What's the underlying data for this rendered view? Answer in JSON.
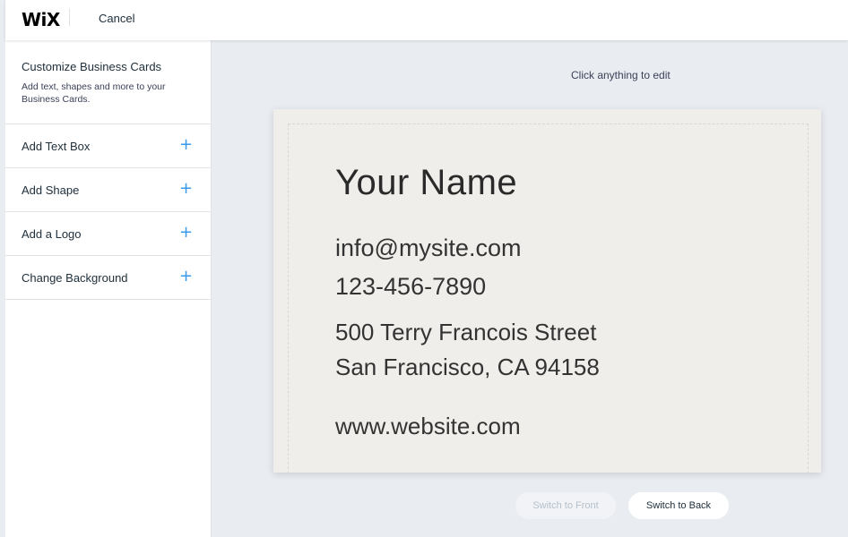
{
  "topbar": {
    "logo": "WiX",
    "cancel_label": "Cancel"
  },
  "sidebar": {
    "title": "Customize Business Cards",
    "description": "Add text, shapes and more to your Business Cards.",
    "items": [
      {
        "label": "Add Text Box",
        "icon": "plus-icon"
      },
      {
        "label": "Add Shape",
        "icon": "plus-icon"
      },
      {
        "label": "Add a Logo",
        "icon": "plus-icon"
      },
      {
        "label": "Change Background",
        "icon": "plus-icon"
      }
    ],
    "plus_glyph": "+"
  },
  "stage": {
    "hint": "Click anything to edit"
  },
  "card": {
    "name": "Your Name",
    "email": "info@mysite.com",
    "phone": "123-456-7890",
    "address_line1": "500 Terry Francois Street",
    "address_line2": "San Francisco, CA 94158",
    "website": "www.website.com",
    "background_color": "#efeeea"
  },
  "switches": {
    "front_label": "Switch to Front",
    "back_label": "Switch to Back"
  },
  "colors": {
    "accent": "#3899ec",
    "canvas": "#e9edf2"
  }
}
